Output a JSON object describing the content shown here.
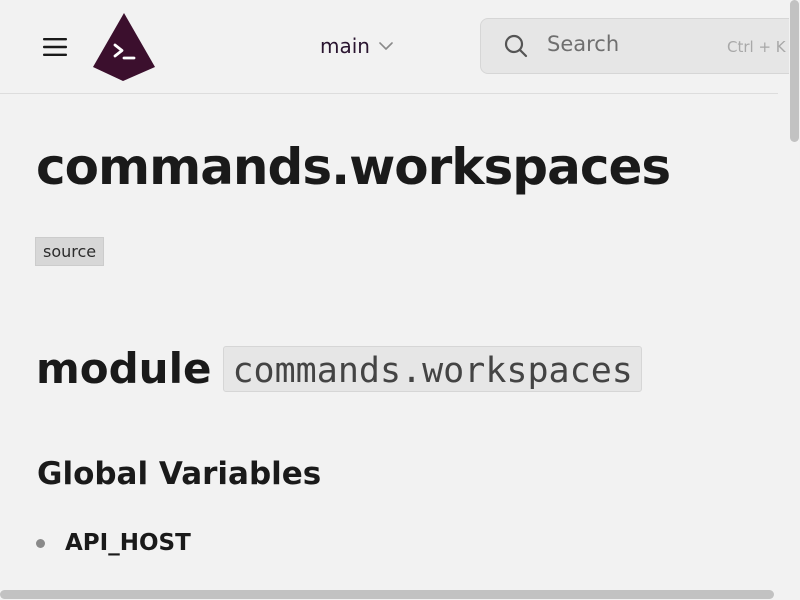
{
  "header": {
    "menu_icon": "hamburger-menu-icon",
    "logo_icon": "terminal-prompt-icon",
    "branch": "main",
    "search_placeholder": "Search",
    "search_shortcut": "Ctrl + K"
  },
  "content": {
    "title": "commands.workspaces",
    "source_label": "source",
    "module_keyword": "module",
    "module_name": "commands.workspaces",
    "globals_heading": "Global Variables",
    "variables": [
      "API_HOST"
    ]
  },
  "colors": {
    "background": "#f2f2f2",
    "logo": "#3b0f2d",
    "text": "#1a1a1a"
  }
}
